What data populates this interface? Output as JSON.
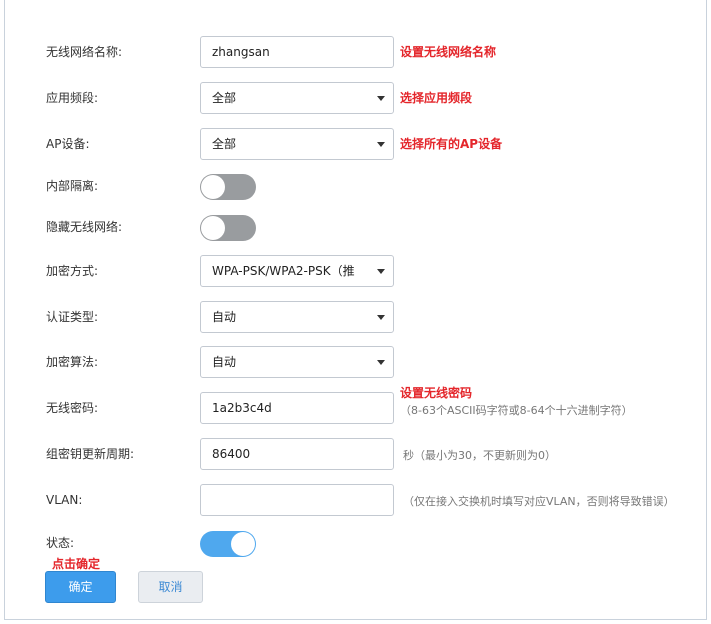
{
  "form": {
    "ssid": {
      "label": "无线网络名称:",
      "value": "zhangsan",
      "annotation": "设置无线网络名称"
    },
    "band": {
      "label": "应用频段:",
      "value": "全部",
      "annotation": "选择应用频段"
    },
    "ap": {
      "label": "AP设备:",
      "value": "全部",
      "annotation": "选择所有的AP设备"
    },
    "isolation": {
      "label": "内部隔离:",
      "state": "off"
    },
    "hide_ssid": {
      "label": "隐藏无线网络:",
      "state": "off"
    },
    "encryption": {
      "label": "加密方式:",
      "value": "WPA-PSK/WPA2-PSK（推"
    },
    "auth": {
      "label": "认证类型:",
      "value": "自动"
    },
    "algorithm": {
      "label": "加密算法:",
      "value": "自动"
    },
    "password": {
      "label": "无线密码:",
      "value": "1a2b3c4d",
      "annotation": "设置无线密码",
      "hint": "（8-63个ASCII码字符或8-64个十六进制字符）"
    },
    "rekey": {
      "label": "组密钥更新周期:",
      "value": "86400",
      "hint": "秒（最小为30，不更新则为0）"
    },
    "vlan": {
      "label": "VLAN:",
      "value": "",
      "hint": "（仅在接入交换机时填写对应VLAN，否则将导致错误）"
    },
    "status": {
      "label": "状态:",
      "state": "on",
      "annotation": "点击确定"
    }
  },
  "buttons": {
    "ok": "确定",
    "cancel": "取消"
  },
  "colors": {
    "accent": "#3d9cec",
    "annotation": "#e4262b",
    "toggle_off": "#999c9f",
    "toggle_on": "#4fa8ee"
  }
}
